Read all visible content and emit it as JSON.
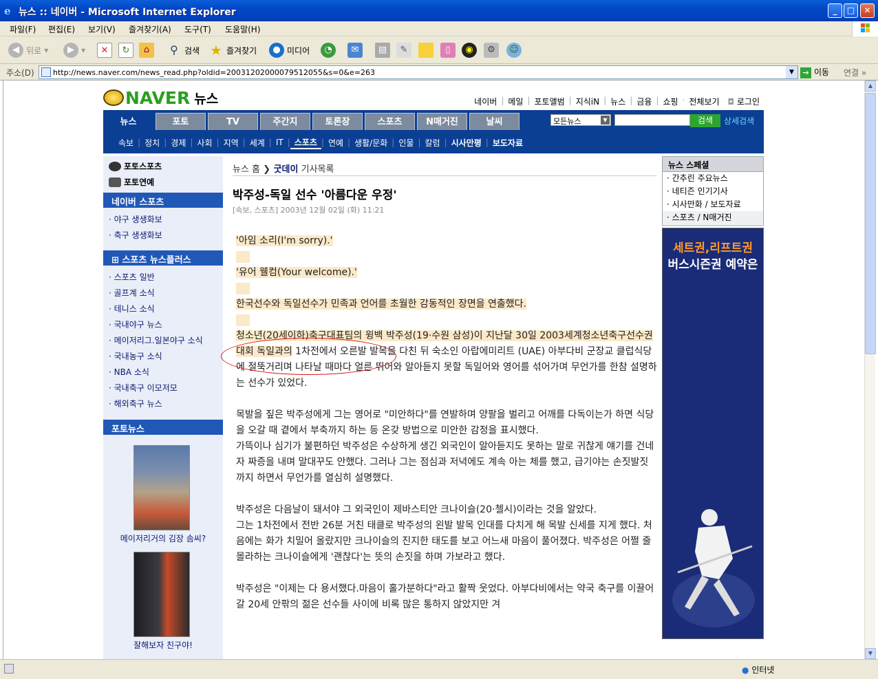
{
  "window": {
    "title": "뉴스 :: 네이버 - Microsoft Internet Explorer",
    "menu": [
      "파일(F)",
      "편집(E)",
      "보기(V)",
      "즐겨찾기(A)",
      "도구(T)",
      "도움말(H)"
    ],
    "toolbar": {
      "back": "뒤로",
      "search": "검색",
      "favorites": "즐겨찾기",
      "media": "미디어"
    },
    "address_label": "주소(D)",
    "url": "http://news.naver.com/news_read.php?oldid=20031202000079512055&s=0&e=263",
    "go": "이동",
    "links": "연결",
    "status_zone": "인터넷"
  },
  "site": {
    "brand": "NAVER",
    "section": "뉴스",
    "top_links": [
      "네이버",
      "메일",
      "포토앨범",
      "지식iN",
      "뉴스",
      "금융",
      "쇼핑",
      "전체보기",
      "로그인"
    ],
    "tabs": [
      "뉴스",
      "포토",
      "TV",
      "주간지",
      "토론장",
      "스포츠",
      "N매거진",
      "날씨"
    ],
    "search_scope": "모든뉴스",
    "search_button": "검색",
    "advanced_search": "상세검색",
    "subnav": [
      "속보",
      "정치",
      "경제",
      "사회",
      "지역",
      "세계",
      "IT",
      "스포츠",
      "연예",
      "생활/문화",
      "인물",
      "칼럼",
      "시사만평",
      "보도자료"
    ]
  },
  "left": {
    "photo_links": [
      "포토스포츠",
      "포토연예"
    ],
    "naver_sports_head": "네이버 스포츠",
    "naver_sports": [
      "야구 생생화보",
      "축구 생생화보"
    ],
    "plus_head": "스포츠 뉴스플러스",
    "plus_items": [
      "스포츠 일반",
      "골프계 소식",
      "테니스 소식",
      "국내야구 뉴스",
      "메이저리그.일본야구 소식",
      "국내농구 소식",
      "NBA 소식",
      "국내축구 이모저모",
      "해외축구 뉴스"
    ],
    "photo_news_head": "포토뉴스",
    "photo_captions": [
      "메이저리거의 김장 솜씨?",
      "잘해보자 친구야!"
    ]
  },
  "article": {
    "crumb_home": "뉴스 홈",
    "crumb_section": "굿데이",
    "crumb_list": "기사목록",
    "title": "박주성-독일 선수 '아름다운 우정'",
    "meta": "[속보, 스포츠] 2003년 12월 02일 (화) 11:21",
    "p1": "'아임 소리(I'm sorry).'",
    "p2": "'유어 웰컴(Your welcome).'",
    "p3": "한국선수와 독일선수가 민족과 언어를 초월한 감동적인 장면을 연출했다.",
    "p4a": "청소년(20세이하)축구대표팀의 윙백 박주성(19·수원 삼성)이 지난달 30일 2003세계청",
    "p4b": "소년축구선수권대회 독일과의",
    "p4c": " 1차전에서 오른발 발목을 다친 뒤 숙소인 아랍에미리트 (UAE) 아부다비 군장교 클럽식당에 절뚝거리며 나타날 때마다 얼른 뛰어와 알아듣지 못할 독일어와 영어를 섞어가며 무언가를 한참 설명하는 선수가 있었다.",
    "p5": "목발을 짚은 박주성에게 그는 영어로 \"미안하다\"를 연발하며 양팔을 벌리고 어깨를 다독이는가 하면 식당을 오갈 때 곁에서 부축까지 하는 등 온갖 방법으로 미안한 감정을 표시했다.",
    "p6": "가뜩이나 심기가 불편하던 박주성은 수상하게 생긴 외국인이 알아듣지도 못하는 말로 귀찮게 얘기를 건네자 짜증을 내며 말대꾸도 안했다. 그러나 그는 점심과 저녁에도 계속 아는 체를 했고, 급기야는 손짓발짓까지 하면서 무언가를 열심히 설명했다.",
    "p7": "박주성은 다음날이 돼서야 그 외국인이 제바스티안 크나이슬(20·첼시)이라는 것을 알았다.",
    "p8": "그는 1차전에서 전반 26분 거친 태클로 박주성의 왼발 발목 인대를 다치게 해 목발 신세를 지게 했다. 처음에는 화가 치밀어 올랐지만 크나이슬의 진지한 태도를 보고 어느새 마음이 풀어졌다. 박주성은 어쩔 줄 몰라하는 크나이슬에게 '괜찮다'는 뜻의 손짓을 하며 가보라고 했다.",
    "p9": "박주성은 \"이제는 다 용서했다.마음이 홀가분하다\"라고 활짝 웃었다. 아부다비에서는 약국 축구를 이끌어갈 20세 안팎의 젊은 선수들 사이에 비록 많은 통하지 않았지만 겨"
  },
  "right": {
    "special_head": "뉴스 스페셜",
    "special_items": [
      "간추린 주요뉴스",
      "네티즌 인기기사",
      "시사만화 / 보도자료",
      "스포츠 / N매거진"
    ],
    "banner_line1": "세트권,리프트권",
    "banner_line2": "버스시즌권 예약은"
  }
}
